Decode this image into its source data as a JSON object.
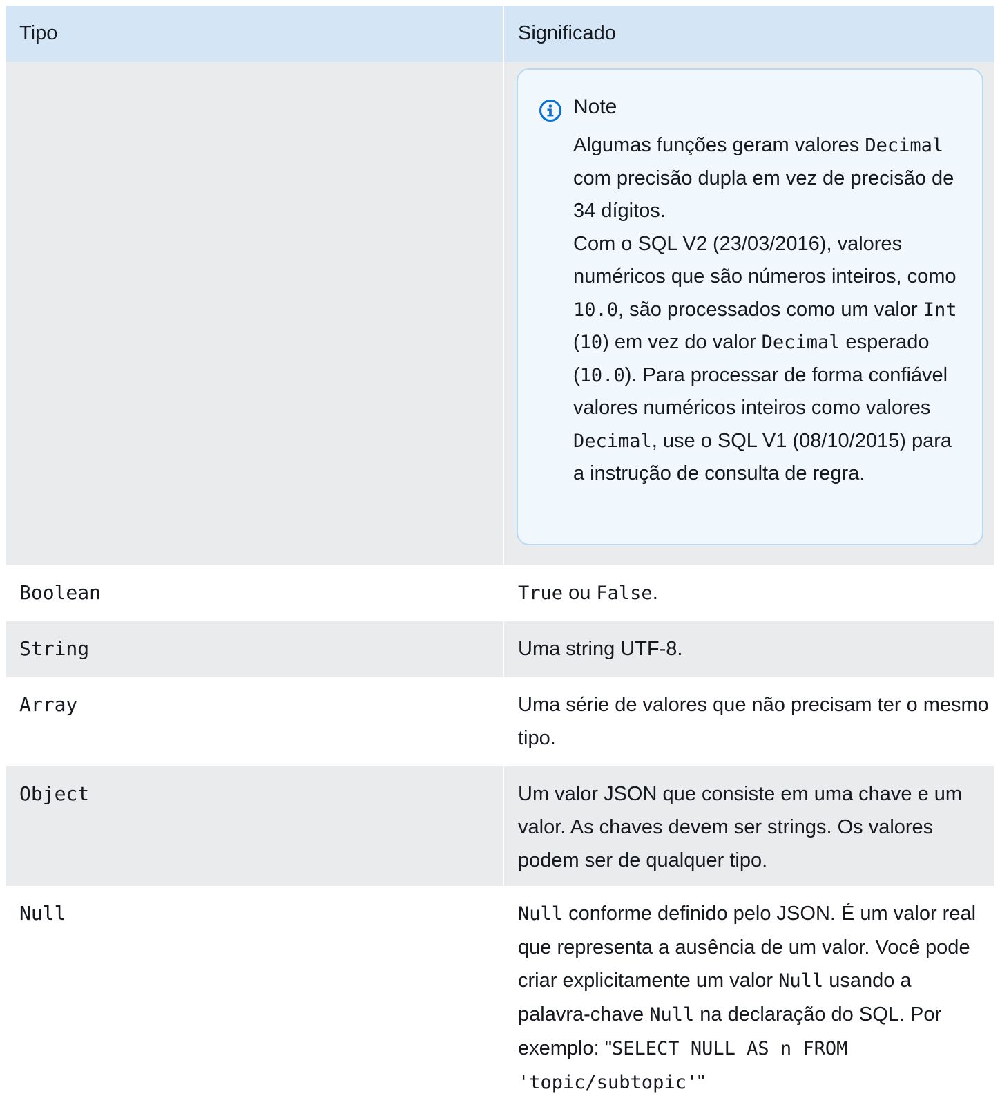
{
  "table": {
    "headers": {
      "type": "Tipo",
      "meaning": "Significado"
    },
    "note": {
      "icon": "info-icon",
      "title": "Note",
      "p1_a": "Algumas funções geram valores ",
      "p1_code": "Decimal",
      "p1_b": " com precisão dupla em vez de precisão de 34 dígitos.",
      "p2_a": "Com o SQL V2 (23/03/2016), valores numéricos que são números inteiros, como ",
      "p2_code1": "10.0",
      "p2_b": ", são processados como um valor ",
      "p2_code2": "Int",
      "p2_c": " (",
      "p2_code3": "10",
      "p2_d": ") em vez do valor ",
      "p2_code4": "Decimal",
      "p2_e": " esperado (",
      "p2_code5": "10.0",
      "p2_f": "). Para processar de forma confiável valores numéricos inteiros como valores ",
      "p2_code6": "Decimal",
      "p2_g": ", use o SQL V1 (08/10/2015) para a instrução de consulta de regra."
    },
    "rows": [
      {
        "type": "Boolean",
        "m_code1": "True",
        "m_text1": " ou ",
        "m_code2": "False",
        "m_text2": "."
      },
      {
        "type": "String",
        "meaning": "Uma string UTF-8."
      },
      {
        "type": "Array",
        "meaning": "Uma série de valores que não precisam ter o mesmo tipo."
      },
      {
        "type": "Object",
        "meaning": "Um valor JSON que consiste em uma chave e um valor. As chaves devem ser strings. Os valores podem ser de qualquer tipo."
      },
      {
        "type": "Null",
        "m_code1": "Null",
        "m_text1": " conforme definido pelo JSON. É um valor real que representa a ausência de um valor. Você pode criar explicitamente um valor ",
        "m_code2": "Null",
        "m_text2": " usando a palavra-chave ",
        "m_code3": "Null",
        "m_text3": " na declaração do SQL. Por exemplo: \"",
        "m_code4": "SELECT NULL AS n FROM 'topic/subtopic'",
        "m_text4": "\""
      }
    ],
    "colors": {
      "header_bg": "#d4e6f6",
      "row_grey": "#e9ebed",
      "note_bg": "#f0f7fd",
      "note_border": "#b7daf2",
      "info_blue": "#0972d3"
    }
  }
}
